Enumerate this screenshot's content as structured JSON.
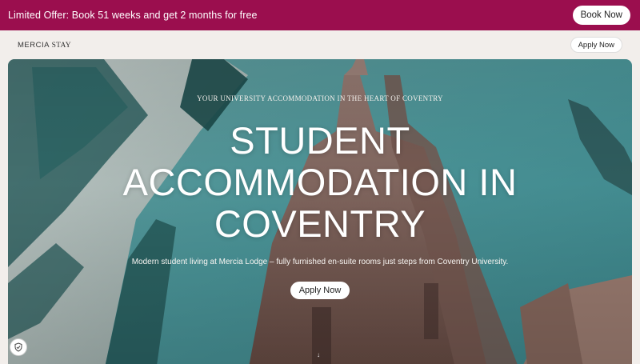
{
  "promo": {
    "text": "Limited Offer: Book 51 weeks and get 2 months for free",
    "button_label": "Book Now"
  },
  "header": {
    "logo_primary": "MERCIA",
    "logo_secondary": "STAY",
    "button_label": "Apply Now"
  },
  "hero": {
    "eyebrow": "YOUR UNIVERSITY ACCOMMODATION IN THE HEART OF COVENTRY",
    "title": "STUDENT ACCOMMODATION IN COVENTRY",
    "subtitle": "Modern student living at Mercia Lodge – fully furnished en-suite rooms just steps from Coventry University.",
    "cta_label": "Apply Now",
    "scroll_glyph": "↓"
  },
  "icons": {
    "cookie": "shield-check-icon",
    "scroll": "arrow-down-icon"
  },
  "colors": {
    "promo_bg": "#9b0e4e",
    "page_bg": "#f2eeeb",
    "sky": "#4f9ea2",
    "stone": "#8a6a60"
  }
}
